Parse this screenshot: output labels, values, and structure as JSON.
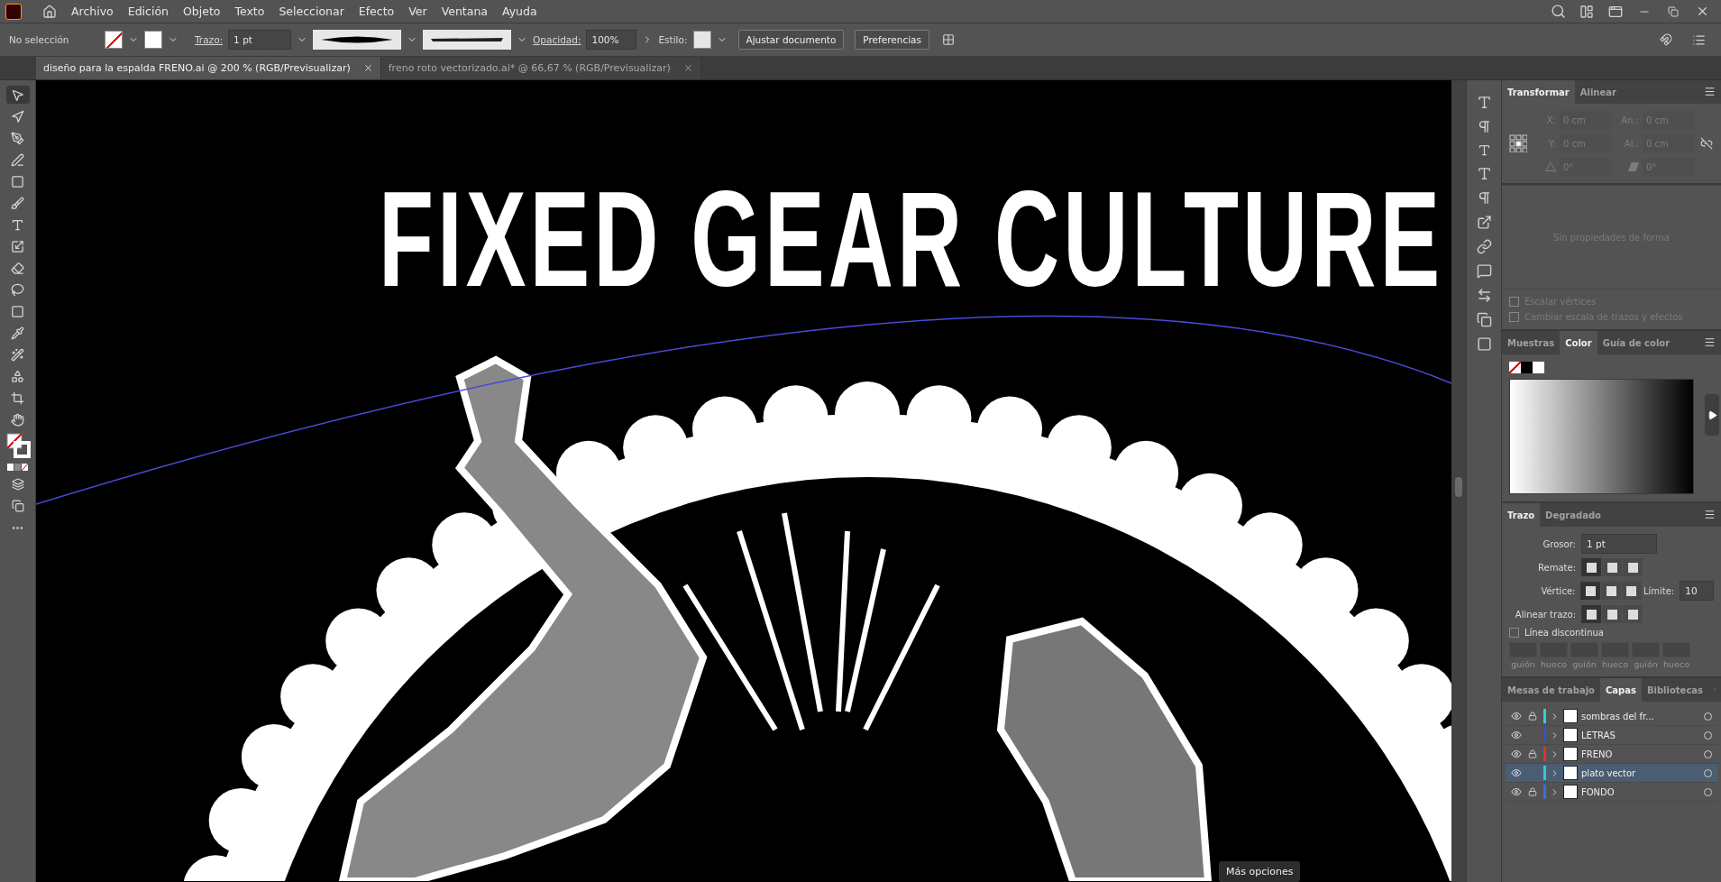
{
  "menu": {
    "items": [
      "Archivo",
      "Edición",
      "Objeto",
      "Texto",
      "Seleccionar",
      "Efecto",
      "Ver",
      "Ventana",
      "Ayuda"
    ]
  },
  "options_bar": {
    "selection": "No selección",
    "stroke_label": "Trazo:",
    "stroke_value": "1 pt",
    "opacity_label": "Opacidad:",
    "opacity_value": "100%",
    "style_label": "Estilo:",
    "buttons": [
      "Ajustar documento",
      "Preferencias"
    ]
  },
  "doc_tabs": [
    {
      "title": "diseño para la espalda FRENO.ai @ 200 % (RGB/Previsualizar)",
      "selected": true
    },
    {
      "title": "freno roto vectorizado.ai* @ 66,67 % (RGB/Previsualizar)",
      "selected": false
    }
  ],
  "tools": [
    {
      "kind": "select",
      "selected": true
    },
    {
      "kind": "direct",
      "selected": false
    },
    {
      "kind": "pen",
      "selected": false
    },
    {
      "kind": "curvature",
      "selected": false
    },
    {
      "kind": "rectangle",
      "selected": false
    },
    {
      "kind": "brush",
      "selected": false
    },
    {
      "kind": "type",
      "selected": false
    },
    {
      "kind": "scale",
      "selected": false
    },
    {
      "kind": "eraser",
      "selected": false
    },
    {
      "kind": "lasso",
      "selected": false
    },
    {
      "kind": "gradient",
      "selected": false
    },
    {
      "kind": "eyedropper",
      "selected": false
    },
    {
      "kind": "puppet",
      "selected": false
    },
    {
      "kind": "shapes",
      "selected": false
    },
    {
      "kind": "crop",
      "selected": false
    },
    {
      "kind": "hand",
      "selected": false
    }
  ],
  "artwork": {
    "headline": "FIXED GEAR CULTURE"
  },
  "tooltip": "Más opciones",
  "transform_panel": {
    "tabs": [
      {
        "label": "Transformar",
        "selected": true
      },
      {
        "label": "Alinear",
        "selected": false
      }
    ],
    "fields": [
      {
        "label": "X:",
        "value": "0 cm"
      },
      {
        "label": "An.:",
        "value": "0 cm"
      },
      {
        "label": "Y:",
        "value": "0 cm"
      },
      {
        "label": "Al.:",
        "value": "0 cm"
      }
    ],
    "angles": [
      {
        "value": "0°"
      },
      {
        "value": "0°"
      }
    ],
    "empty_message": "Sin propiedades de forma",
    "checkboxes": [
      {
        "label": "Escalar vértices",
        "checked": false
      },
      {
        "label": "Cambiar escala de trazos y efectos",
        "checked": false
      }
    ]
  },
  "color_panel": {
    "tabs": [
      {
        "label": "Muestras",
        "selected": false
      },
      {
        "label": "Color",
        "selected": true
      },
      {
        "label": "Guía de color",
        "selected": false
      }
    ]
  },
  "stroke_panel": {
    "tabs": [
      {
        "label": "Trazo",
        "selected": true
      },
      {
        "label": "Degradado",
        "selected": false
      }
    ],
    "weight_label": "Grosor:",
    "weight_value": "1 pt",
    "cap_label": "Remate:",
    "corner_label": "Vértice:",
    "limit_label": "Límite:",
    "limit_value": "10",
    "align_label": "Alinear trazo:",
    "dashed": {
      "label": "Línea discontinua",
      "checked": false
    },
    "dash_labels": [
      "guión",
      "hueco",
      "guión",
      "hueco",
      "guión",
      "hueco"
    ]
  },
  "layers_panel": {
    "tabs": [
      {
        "label": "Mesas de trabajo",
        "selected": false
      },
      {
        "label": "Capas",
        "selected": true
      },
      {
        "label": "Bibliotecas",
        "selected": false
      }
    ],
    "layers": [
      {
        "name": "sombras del fr...",
        "color": "#2ed3d3",
        "locked": true,
        "selected": false
      },
      {
        "name": "LETRAS",
        "color": "#4646dc",
        "locked": false,
        "selected": false
      },
      {
        "name": "FRENO",
        "color": "#dc3434",
        "locked": true,
        "selected": false
      },
      {
        "name": "plato vector",
        "color": "#26d0d0",
        "locked": false,
        "selected": true
      },
      {
        "name": "FONDO",
        "color": "#3c6ee0",
        "locked": true,
        "selected": false
      }
    ]
  }
}
